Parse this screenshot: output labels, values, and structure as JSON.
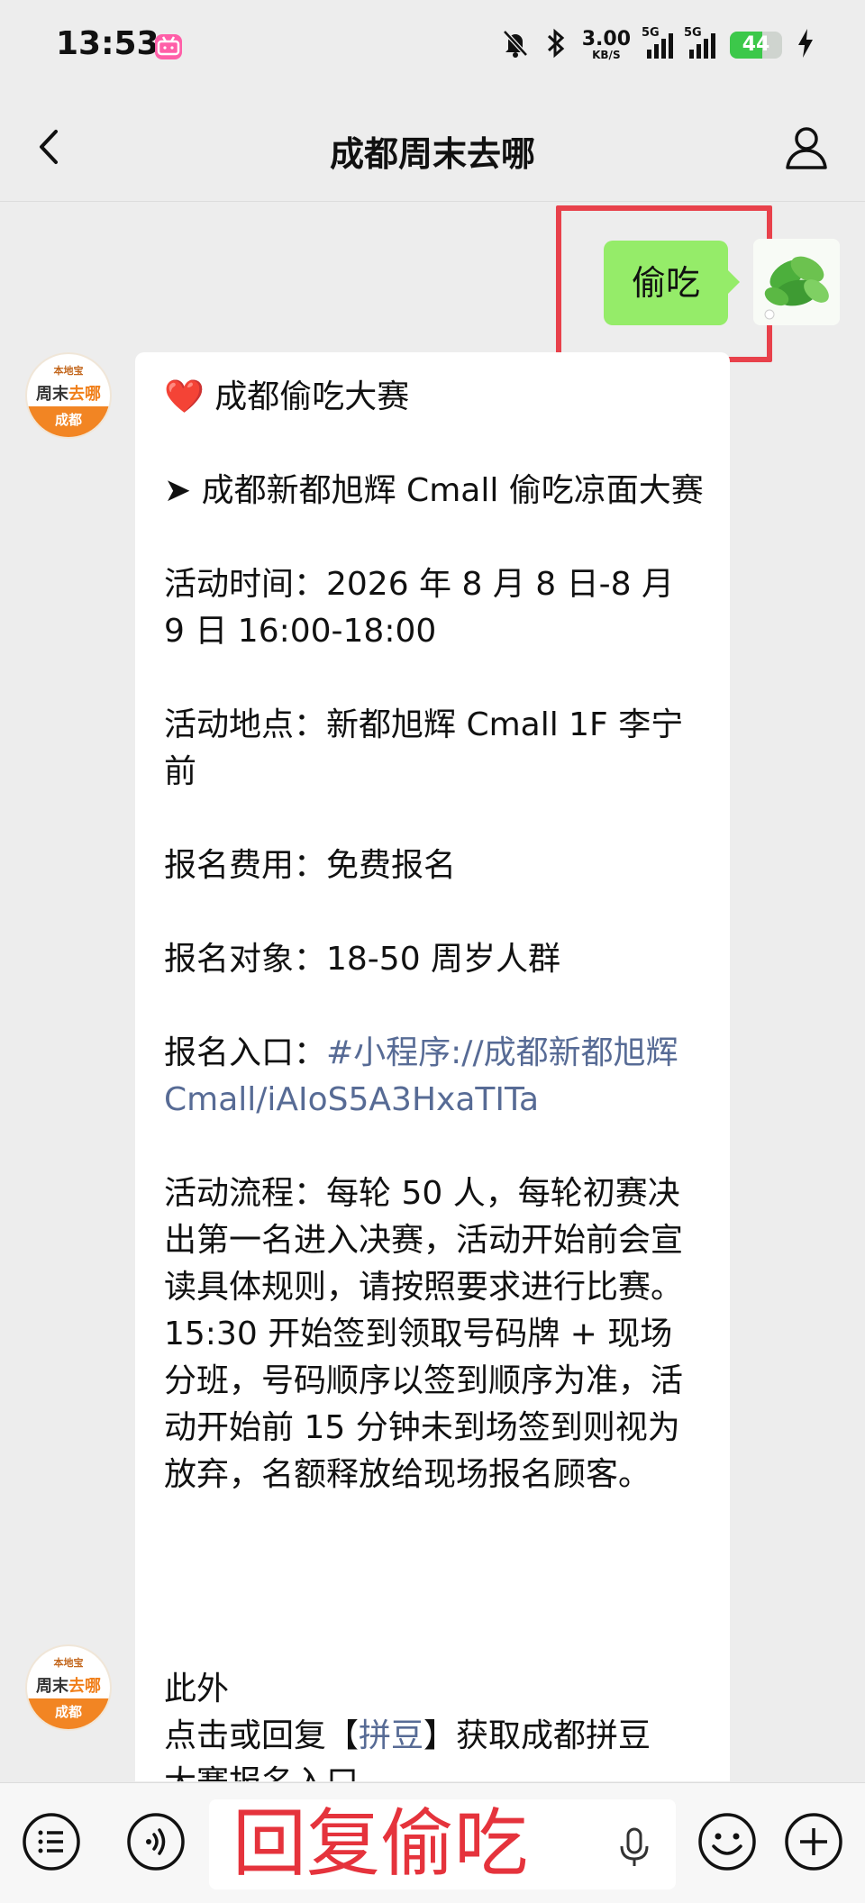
{
  "status_bar": {
    "time": "13:53",
    "app_badge": "bilibili",
    "net_speed_value": "3.00",
    "net_speed_unit": "KB/S",
    "signal1_label": "5G",
    "signal2_label": "5G",
    "battery_level": "44"
  },
  "nav": {
    "title": "成都周末去哪"
  },
  "chat": {
    "outgoing": {
      "text": "偷吃"
    },
    "bot_avatar": {
      "top": "本地宝",
      "mid_a": "周末",
      "mid_b": "去哪",
      "bottom": "成都"
    },
    "message1": {
      "line_title_icon": "❤️",
      "line_title": "成都偷吃大赛",
      "line_event": "➤ 成都新都旭辉 Cmall 偷吃凉面大赛",
      "line_time": "活动时间：2026 年 8 月 8 日-8 月 9 日 16:00-18:00",
      "line_place": "活动地点：新都旭辉 Cmall 1F 李宁前",
      "line_fee": "报名费用：免费报名",
      "line_target": "报名对象：18-50 周岁人群",
      "entry_label": "报名入口：",
      "entry_link": "#小程序://成都新都旭辉 Cmall/iAIoS5A3HxaTITa",
      "line_flow": "活动流程：每轮 50 人，每轮初赛决出第一名进入决赛，活动开始前会宣读具体规则，请按照要求进行比赛。15:30 开始签到领取号码牌 + 现场分班，号码顺序以签到顺序为准，活动开始前 15 分钟未到场签到则视为放弃，名额释放给现场报名顾客。"
    },
    "message2": {
      "line1": "此外",
      "line2_prefix": "点击或回复【",
      "line2_link": "拼豆",
      "line2_suffix": "】获取成都拼豆",
      "line3": "大赛报名入口"
    }
  },
  "input_bar": {
    "field_text": "回复偷吃"
  },
  "colors": {
    "background": "#ededed",
    "outgoing_bubble": "#95ec69",
    "link": "#576b95",
    "highlight": "#e8414b",
    "annotation_text": "#e5333c"
  }
}
